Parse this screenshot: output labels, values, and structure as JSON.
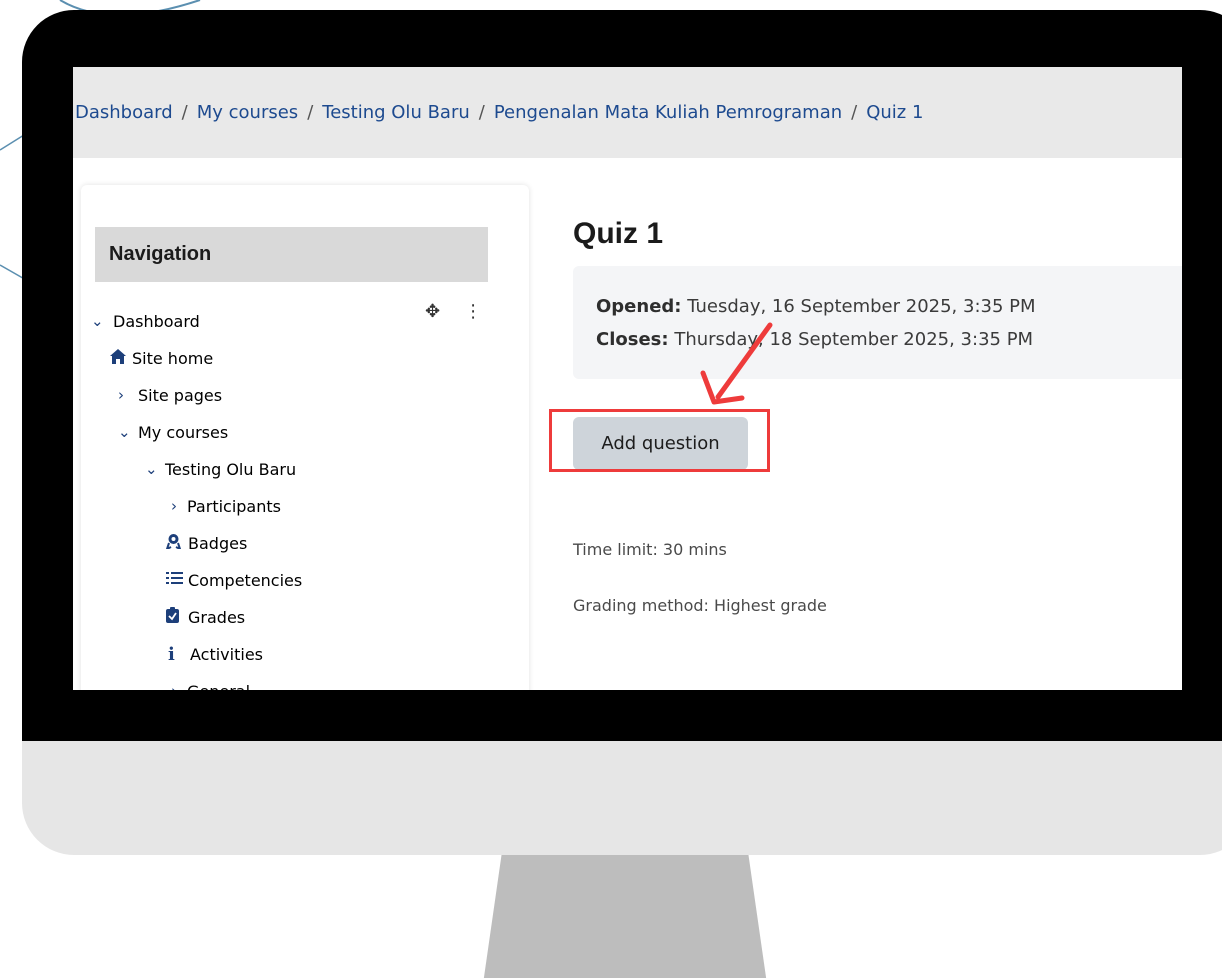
{
  "breadcrumb": [
    "Dashboard",
    "My courses",
    "Testing Olu Baru",
    "Pengenalan Mata Kuliah Pemrograman",
    "Quiz 1"
  ],
  "breadcrumb_separator": "/",
  "navigation": {
    "title": "Navigation",
    "items": [
      {
        "label": "Dashboard",
        "icon": "chevron-down-icon"
      },
      {
        "label": "Site home",
        "icon": "home-icon"
      },
      {
        "label": "Site pages",
        "icon": "chevron-right-icon"
      },
      {
        "label": "My courses",
        "icon": "chevron-down-icon"
      },
      {
        "label": "Testing Olu Baru",
        "icon": "chevron-down-icon"
      },
      {
        "label": "Participants",
        "icon": "chevron-right-icon"
      },
      {
        "label": "Badges",
        "icon": "badge-icon"
      },
      {
        "label": "Competencies",
        "icon": "competencies-icon"
      },
      {
        "label": "Grades",
        "icon": "grades-icon"
      },
      {
        "label": "Activities",
        "icon": "info-icon"
      },
      {
        "label": "General",
        "icon": "chevron-right-icon"
      }
    ]
  },
  "quiz": {
    "title": "Quiz 1",
    "opened_label": "Opened:",
    "opened_value": "Tuesday, 16 September 2025, 3:35 PM",
    "closes_label": "Closes:",
    "closes_value": "Thursday, 18 September 2025, 3:35 PM",
    "add_question_label": "Add question",
    "time_limit": "Time limit: 30 mins",
    "grading_method": "Grading method: Highest grade"
  },
  "colors": {
    "link": "#1d4a8f",
    "highlight": "#ee3b3b",
    "button": "#ced4da"
  }
}
